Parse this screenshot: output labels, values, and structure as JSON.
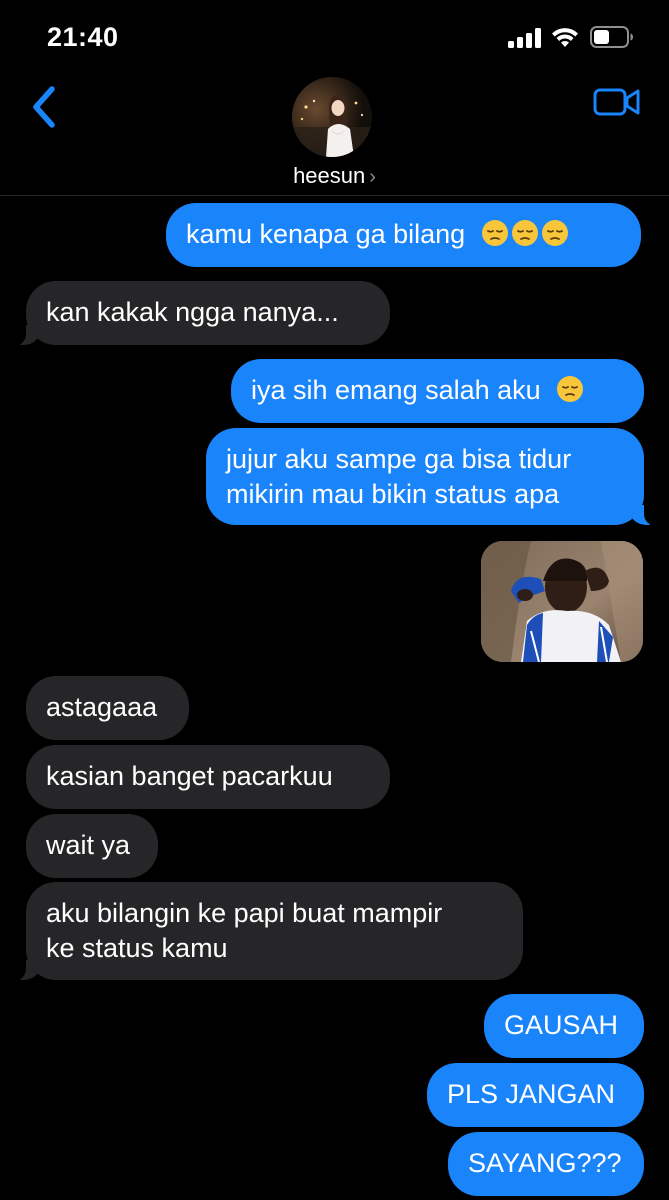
{
  "status_bar": {
    "time": "21:40",
    "icons": [
      "signal-icon",
      "wifi-icon",
      "battery-icon"
    ]
  },
  "header": {
    "contact_name": "heesun",
    "chevron": "›",
    "back_icon": "chevron-left-icon",
    "video_icon": "video-camera-icon"
  },
  "colors": {
    "accent": "#1a84fb",
    "received_bubble": "#262628",
    "background": "#000000"
  },
  "messages": [
    {
      "from": "me",
      "text": "kamu kenapa ga bilang",
      "emoji": [
        "pensive-face-icon",
        "pensive-face-icon",
        "pensive-face-icon"
      ]
    },
    {
      "from": "them",
      "text": "kan kakak ngga nanya..."
    },
    {
      "from": "me",
      "text": "iya sih emang salah aku",
      "emoji": [
        "pensive-face-icon"
      ]
    },
    {
      "from": "me",
      "lines": [
        "jujur aku sampe ga bisa tidur",
        "mikirin mau bikin status apa"
      ]
    },
    {
      "from": "me",
      "type": "image",
      "image": "photo-of-child-sitting-on-couch"
    },
    {
      "from": "them",
      "text": "astagaaa"
    },
    {
      "from": "them",
      "text": "kasian banget pacarkuu"
    },
    {
      "from": "them",
      "text": "wait ya"
    },
    {
      "from": "them",
      "lines": [
        "aku bilangin ke papi buat mampir",
        "ke status kamu"
      ]
    },
    {
      "from": "me",
      "text": "GAUSAH"
    },
    {
      "from": "me",
      "text": "PLS JANGAN"
    },
    {
      "from": "me",
      "text": "SAYANG???"
    }
  ]
}
